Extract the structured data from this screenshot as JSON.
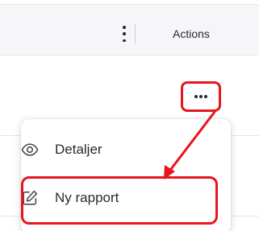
{
  "table": {
    "actions_header": "Actions"
  },
  "menu": {
    "items": [
      {
        "label": "Detaljer",
        "icon": "eye-icon"
      },
      {
        "label": "Ny rapport",
        "icon": "edit-icon"
      }
    ]
  },
  "annotation": {
    "highlight_color": "#e8141e"
  },
  "icons": {
    "column_menu": "vertical-ellipsis-icon",
    "row_actions": "horizontal-ellipsis-icon"
  }
}
